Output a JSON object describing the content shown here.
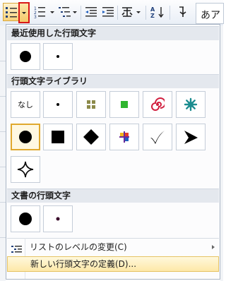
{
  "toolbar": {
    "style_preview": "あア",
    "buttons": [
      "bullets",
      "bullets-dropdown",
      "numbering",
      "multilevel-list",
      "decrease-indent",
      "increase-indent",
      "asian-layout",
      "sort",
      "show-marks"
    ]
  },
  "dropdown": {
    "recent_header": "最近使用した行頭文字",
    "library_header": "行頭文字ライブラリ",
    "document_header": "文書の行頭文字",
    "none_label": "なし",
    "recent_items": [
      "large-black-circle",
      "small-dot"
    ],
    "library_items": [
      "none",
      "small-dot",
      "olive-squares",
      "green-square",
      "red-spiral",
      "teal-flower",
      "large-black-circle",
      "black-square",
      "black-diamond",
      "colored-cross",
      "checkmark",
      "arrowhead",
      "four-point-star"
    ],
    "document_items": [
      "large-black-circle",
      "small-red-dot"
    ],
    "selected_item": "large-black-circle",
    "menu_change_level": "リストのレベルの変更(C)",
    "menu_define_new": "新しい行頭文字の定義(D)...",
    "colors": {
      "highlight": "#fde8a8",
      "selected_border": "#e0a82e",
      "header_bg": "#e4e8ee",
      "spiral": "#d11f3f",
      "flower": "#1b8c8f",
      "green": "#2fb52f"
    }
  }
}
